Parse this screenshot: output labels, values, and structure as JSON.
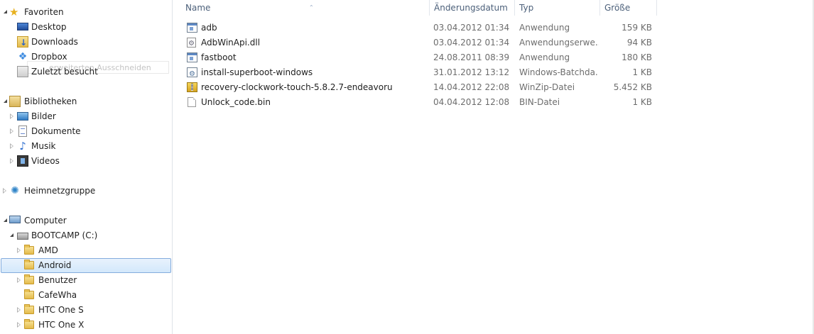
{
  "nav": {
    "favorites": {
      "label": "Favoriten",
      "items": [
        {
          "label": "Desktop",
          "icon": "desktop-icon"
        },
        {
          "label": "Downloads",
          "icon": "downloads-folder-icon"
        },
        {
          "label": "Dropbox",
          "icon": "dropbox-icon"
        },
        {
          "label": "Zuletzt besucht",
          "icon": "recent-places-icon"
        }
      ]
    },
    "drag_ghost": "erweiterten Ausschneiden",
    "libraries": {
      "label": "Bibliotheken",
      "items": [
        {
          "label": "Bilder",
          "icon": "pictures-icon"
        },
        {
          "label": "Dokumente",
          "icon": "documents-icon"
        },
        {
          "label": "Musik",
          "icon": "music-icon"
        },
        {
          "label": "Videos",
          "icon": "videos-icon"
        }
      ]
    },
    "homegroup": {
      "label": "Heimnetzgruppe",
      "icon": "homegroup-icon"
    },
    "computer": {
      "label": "Computer",
      "drive": {
        "label": "BOOTCAMP (C:)",
        "icon": "drive-icon"
      },
      "folders": [
        {
          "label": "AMD",
          "has_children": true
        },
        {
          "label": "Android",
          "has_children": false,
          "selected": true
        },
        {
          "label": "Benutzer",
          "has_children": true
        },
        {
          "label": "CafeWha",
          "has_children": false
        },
        {
          "label": "HTC One S",
          "has_children": true
        },
        {
          "label": "HTC One X",
          "has_children": true
        }
      ]
    }
  },
  "list": {
    "columns": {
      "name": "Name",
      "date": "Änderungsdatum",
      "type": "Typ",
      "size": "Größe"
    },
    "files": [
      {
        "name": "adb",
        "date": "03.04.2012 01:34",
        "type": "Anwendung",
        "size": "159 KB",
        "icon": "application-icon"
      },
      {
        "name": "AdbWinApi.dll",
        "date": "03.04.2012 01:34",
        "type": "Anwendungserwe...",
        "size": "94 KB",
        "icon": "dll-icon"
      },
      {
        "name": "fastboot",
        "date": "24.08.2011 08:39",
        "type": "Anwendung",
        "size": "180 KB",
        "icon": "application-icon"
      },
      {
        "name": "install-superboot-windows",
        "date": "31.01.2012 13:12",
        "type": "Windows-Batchda...",
        "size": "1 KB",
        "icon": "batch-file-icon"
      },
      {
        "name": "recovery-clockwork-touch-5.8.2.7-endeavoru",
        "date": "14.04.2012 22:08",
        "type": "WinZip-Datei",
        "size": "5.452 KB",
        "icon": "zip-file-icon"
      },
      {
        "name": "Unlock_code.bin",
        "date": "04.04.2012 12:08",
        "type": "BIN-Datei",
        "size": "1 KB",
        "icon": "bin-file-icon"
      }
    ]
  },
  "colors": {
    "selection_bg": "#d3e8fb",
    "selection_border": "#84acdd",
    "header_text": "#4c607a",
    "detail_text": "#6d6d6d"
  }
}
